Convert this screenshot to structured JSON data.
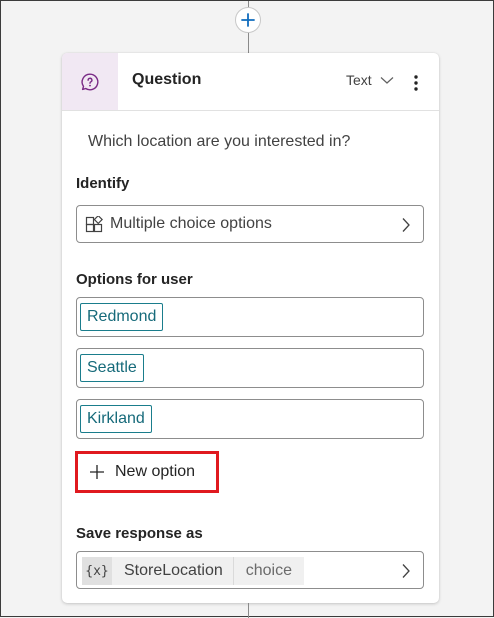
{
  "canvas": {
    "add_node_icon": "plus-icon",
    "accent_color": "#0f6cbd"
  },
  "card": {
    "header": {
      "icon": "question-bubble-icon",
      "title": "Question",
      "type_label": "Text",
      "type_icon": "chevron-down-icon",
      "more_icon": "more-vertical-icon"
    },
    "question_text": "Which location are you interested in?",
    "identify": {
      "label": "Identify",
      "icon": "grid-icon",
      "value": "Multiple choice options"
    },
    "options": {
      "label": "Options for user",
      "items": [
        "Redmond",
        "Seattle",
        "Kirkland"
      ],
      "chip_color": "#1a7d8c",
      "new_option_label": "New option",
      "highlight_color": "#e0191f"
    },
    "save": {
      "label": "Save response as",
      "variable_icon": "{x}",
      "variable_name": "StoreLocation",
      "variable_type": "choice"
    }
  }
}
